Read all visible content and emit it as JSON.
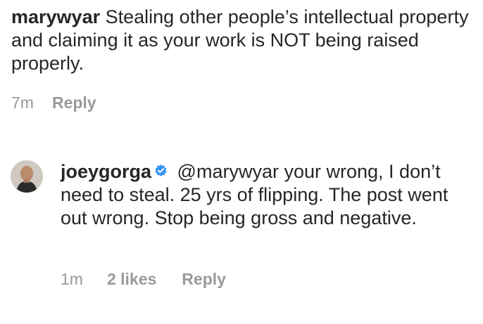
{
  "comment": {
    "username": "marywyar",
    "text": "Stealing other people’s intellectual property and claiming it as your work is NOT being raised properly.",
    "time": "7m",
    "reply_label": "Reply"
  },
  "reply": {
    "username": "joeygorga",
    "verified_icon": "verified-badge-icon",
    "mention": "@marywyar",
    "text": "your wrong, I don’t need to steal. 25 yrs of flipping. The post went out wrong. Stop being gross and negative.",
    "time": "1m",
    "likes": "2 likes",
    "reply_label": "Reply",
    "badge_color": "#3897f0"
  }
}
